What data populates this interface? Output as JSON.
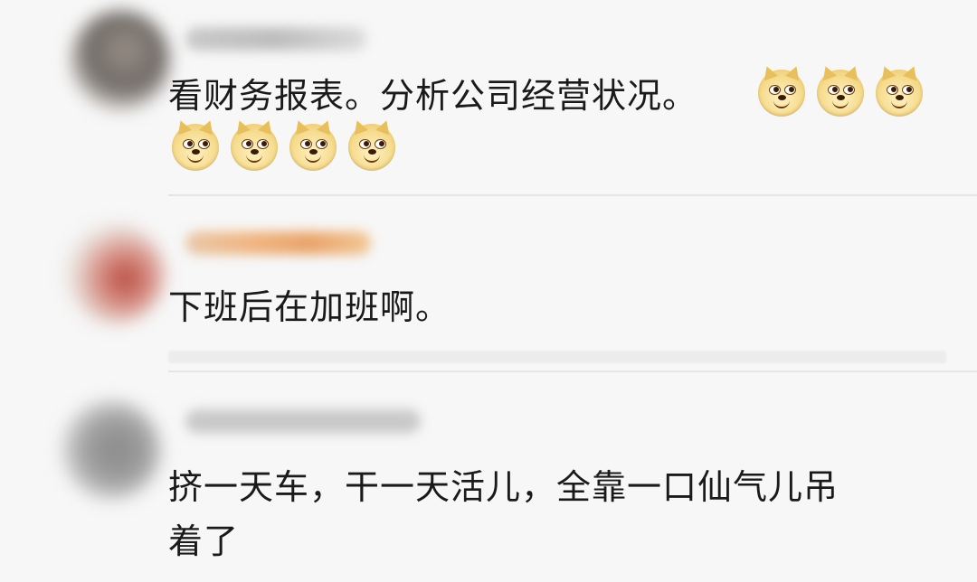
{
  "comments": [
    {
      "text": "看财务报表。分析公司经营状况。",
      "emoji": "doge",
      "emoji_count": 7
    },
    {
      "text": "下班后在加班啊。"
    },
    {
      "text_line1": "挤一天车，干一天活儿，全靠一口仙气儿吊",
      "text_line2": "着了"
    }
  ],
  "colors": {
    "background": "#f7f7f7",
    "text": "#1a1a1a",
    "divider": "#e6e6e6"
  }
}
